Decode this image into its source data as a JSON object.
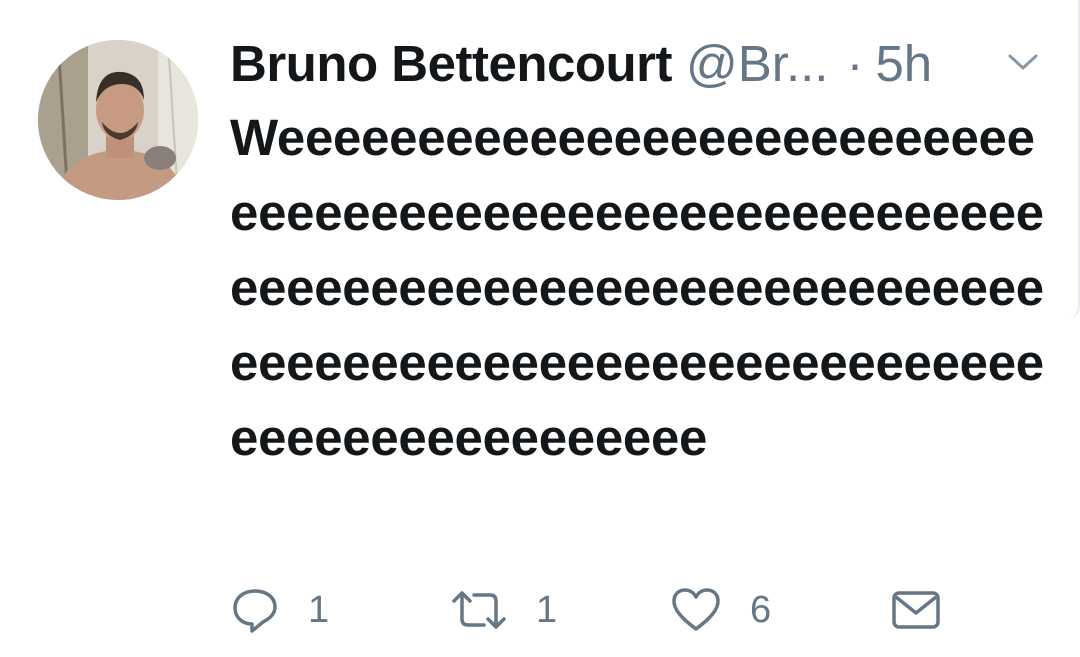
{
  "tweet": {
    "author_name": "Bruno Bettencourt",
    "handle": "@Br...",
    "separator": "·",
    "time": "5h",
    "text": "Weeeeeeeeeeeeeeeeeeeeeeeeeeeeeeeeeeeeeeeeeeeeeeeeeeeeeeeeeeeeeeeeeeeeeeeeeeeeeeeeeeeeeeeeeeeeeeeeeeeeeeeeeeeeeeeeeeeeeeeeeeeeeeeeeee"
  },
  "actions": {
    "reply_count": "1",
    "retweet_count": "1",
    "like_count": "6"
  },
  "colors": {
    "text": "#14171a",
    "secondary": "#657786",
    "divider": "#e6ecf0"
  },
  "icons": [
    "avatar-photo",
    "chevron-down-icon",
    "reply-icon",
    "retweet-icon",
    "heart-icon",
    "envelope-icon"
  ]
}
